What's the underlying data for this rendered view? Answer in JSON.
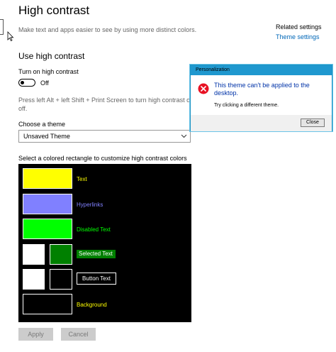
{
  "page": {
    "title": "High contrast",
    "description": "Make text and apps easier to see by using more distinct colors."
  },
  "related": {
    "heading": "Related settings",
    "link": "Theme settings"
  },
  "high_contrast": {
    "section_title": "Use high contrast",
    "toggle_label": "Turn on high contrast",
    "toggle_state": "Off",
    "shortcut_text": "Press left Alt + left Shift + Print Screen to turn high contrast on and off."
  },
  "theme": {
    "label": "Choose a theme",
    "selected": "Unsaved Theme"
  },
  "palette": {
    "label": "Select a colored rectangle to customize high contrast colors",
    "items": [
      {
        "label": "Text",
        "color": "#ffff00",
        "label_color": "#ffff00"
      },
      {
        "label": "Hyperlinks",
        "color": "#8080ff",
        "label_color": "#8080ff"
      },
      {
        "label": "Disabled Text",
        "color": "#00ff00",
        "label_color": "#00ff00"
      },
      {
        "label": "Selected Text",
        "color": "#ffffff",
        "secondary_color": "#008000",
        "label_color": "#ffffff"
      },
      {
        "label": "Button Text",
        "color": "#ffffff",
        "secondary_color": "#000000",
        "label_color": "#ffffff"
      },
      {
        "label": "Background",
        "color": "#000000",
        "label_color": "#ffff00"
      }
    ]
  },
  "actions": {
    "apply": "Apply",
    "cancel": "Cancel"
  },
  "dialog": {
    "title": "Personalization",
    "message": "This theme can't be applied to the desktop.",
    "sub_message": "Try clicking a different theme.",
    "close": "Close",
    "icon": "error-icon"
  }
}
